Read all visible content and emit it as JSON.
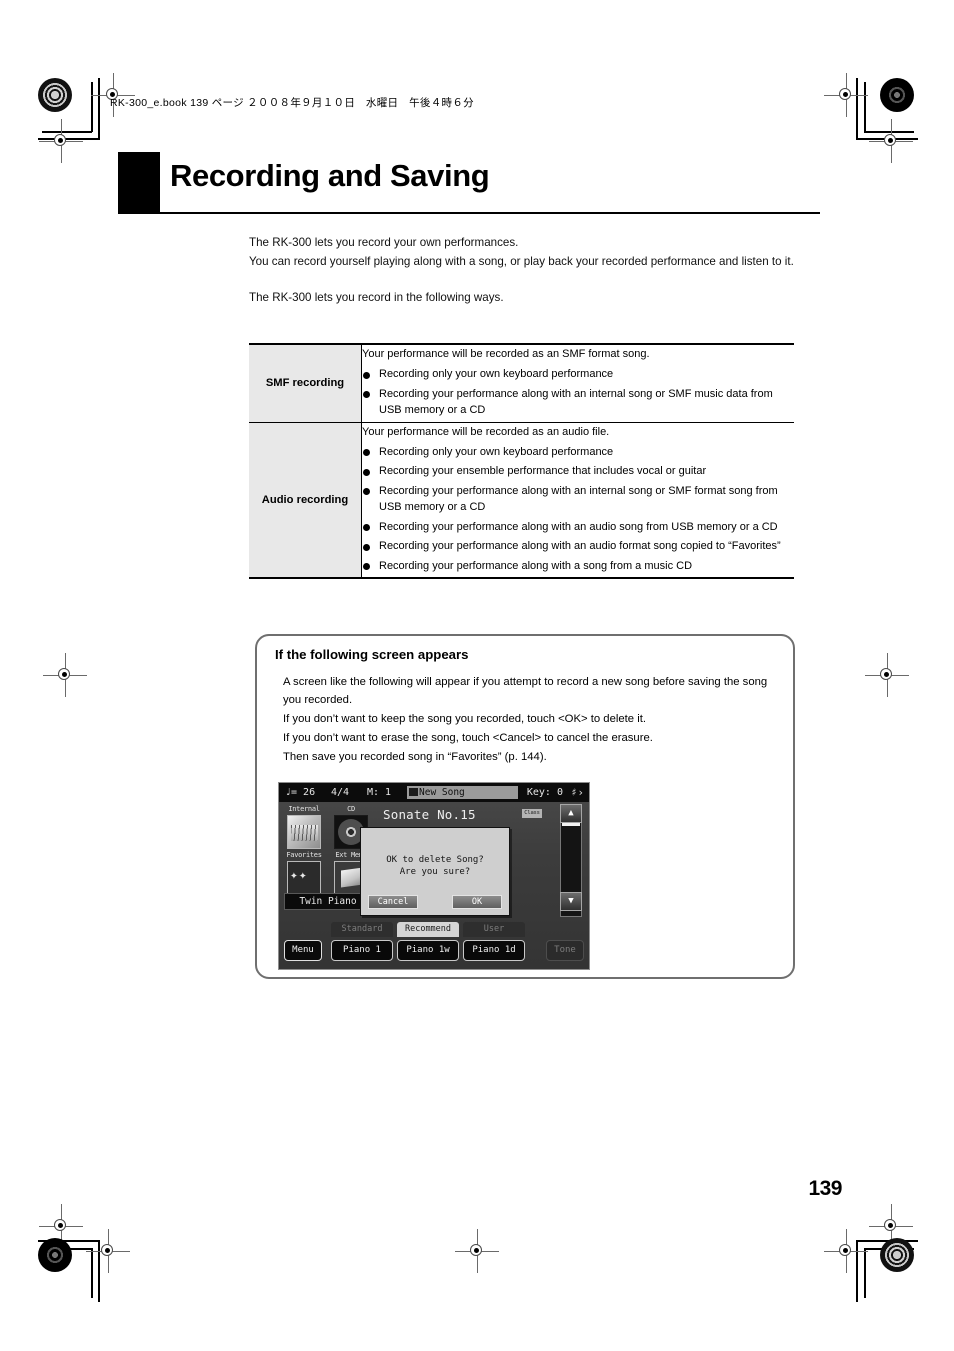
{
  "print": {
    "file_stamp": "RK-300_e.book  139 ページ  ２００８年９月１０日　水曜日　午後４時６分"
  },
  "chapter": {
    "title": "Recording and Saving"
  },
  "intro": {
    "line1": "The RK-300 lets you record your own performances.",
    "line2": "You can record yourself playing along with a song, or play back your recorded performance and listen to it.",
    "line3": "The RK-300 lets you record in the following ways."
  },
  "table": {
    "rows": [
      {
        "label": "SMF recording",
        "lead": "Your performance will be recorded as an SMF format song.",
        "bullets": [
          "Recording only your own keyboard performance",
          "Recording your performance along with an internal song or SMF music data from USB memory or a CD"
        ]
      },
      {
        "label": "Audio recording",
        "lead": "Your performance will be recorded as an audio file.",
        "bullets": [
          "Recording only your own keyboard performance",
          "Recording your ensemble performance that includes vocal or guitar",
          "Recording your performance along with an internal song or SMF format song from USB memory or a CD",
          "Recording your performance along with an audio song from USB memory or a CD",
          "Recording your performance along with an audio  format song copied to “Favorites”",
          "Recording your performance along with a song from a music CD"
        ]
      }
    ]
  },
  "note": {
    "title": "If the following screen appears",
    "paragraphs": [
      "A screen like the following will appear if you attempt to record a new song before saving the song you recorded.",
      "If you don’t want to keep the song you recorded, touch <OK> to delete it.",
      "If you don’t want to erase the song, touch <Cancel> to cancel the erasure.",
      "Then save you recorded song in “Favorites” (p. 144)."
    ]
  },
  "lcd": {
    "topbar": {
      "tempo": "♩= 26",
      "beat": "4/4",
      "measure": "M:  1",
      "song_name": "New Song",
      "song_icon": "song-icon",
      "key": "Key: 0",
      "transpose_icon": "transpose-icon"
    },
    "sources": [
      {
        "caption": "Internal",
        "icon": "internal-piano-icon"
      },
      {
        "caption": "CD",
        "icon": "cd-disc-icon"
      },
      {
        "caption": "Favorites",
        "icon": "favorites-sparkle-icon"
      },
      {
        "caption": "Ext Memo",
        "icon": "external-memory-icon"
      }
    ],
    "twin_piano": "Twin Piano",
    "song_list": {
      "title": "Sonate No.15",
      "subtitle": "",
      "badge": "Class"
    },
    "scrollbar": {
      "up_icon": "scroll-up-icon",
      "down_icon": "scroll-down-icon"
    },
    "dialog": {
      "message_line1": "OK to delete Song?",
      "message_line2": "Are you sure?",
      "cancel_label": "Cancel",
      "ok_label": "OK"
    },
    "tabs": [
      {
        "label": "Standard",
        "active": false
      },
      {
        "label": "Recommend",
        "active": true
      },
      {
        "label": "User",
        "active": false
      }
    ],
    "menu_label": "Menu",
    "tones": [
      "Piano 1",
      "Piano 1w",
      "Piano 1d"
    ],
    "tone_label": "Tone"
  },
  "footer": {
    "page_number": "139"
  }
}
